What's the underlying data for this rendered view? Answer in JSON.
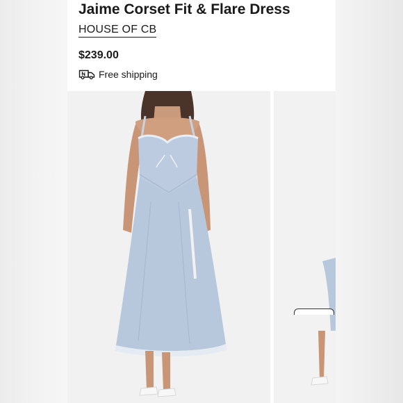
{
  "product": {
    "title": "Jaime Corset Fit & Flare Dress",
    "brand": "HOUSE OF CB",
    "price": "$239.00",
    "shipping": "Free shipping"
  },
  "gallery": {
    "images": [
      {
        "alt": "Model wearing light blue corset midi dress, front view"
      },
      {
        "alt": "Next product photo, partially visible"
      }
    ]
  },
  "colors": {
    "text": "#1a1a1a",
    "dress": "#b9c9de",
    "photo_bg": "#f1f1f1"
  },
  "icons": {
    "shipping": "truck-icon"
  }
}
